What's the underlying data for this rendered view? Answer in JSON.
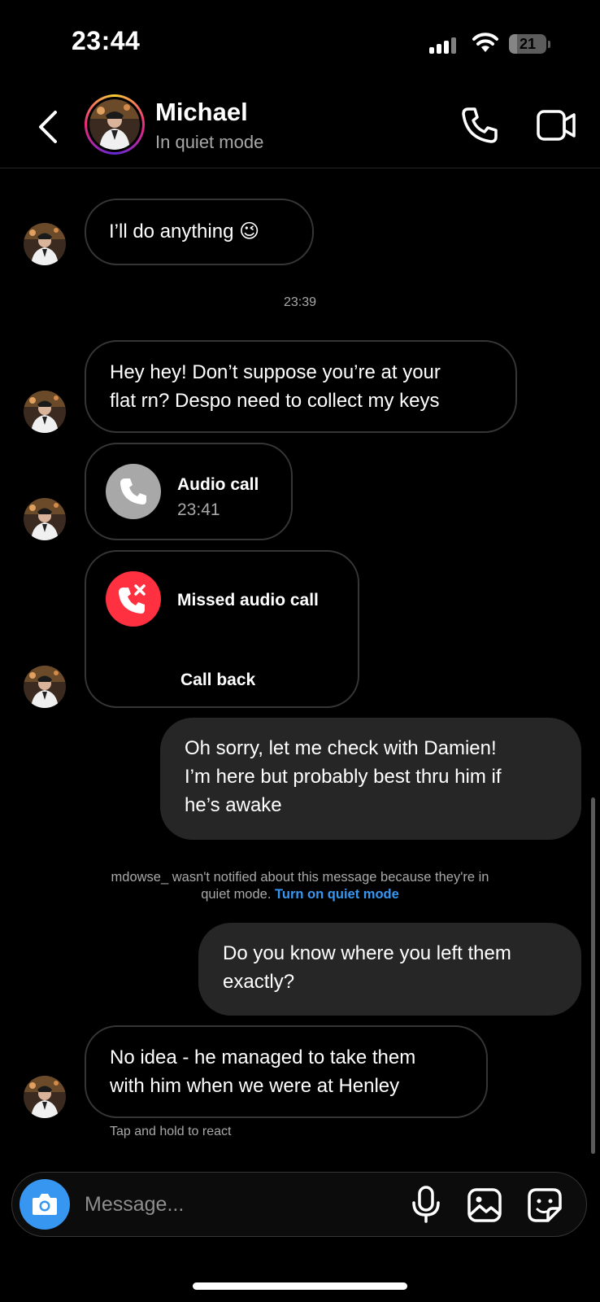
{
  "status_bar": {
    "time": "23:44",
    "battery": "21",
    "battery_level": 0.21
  },
  "header": {
    "name": "Michael",
    "status": "In quiet mode",
    "icons": {
      "back": "chevron-left-icon",
      "call": "phone-icon",
      "video": "video-camera-icon"
    }
  },
  "messages": {
    "m1": {
      "text": "I’ll do anything 😉"
    },
    "time1": "23:39",
    "m2": {
      "line1": "Hey hey! Don’t suppose you’re at your",
      "line2": "flat rn? Despo need to collect my keys"
    },
    "audio_call": {
      "title": "Audio call",
      "time": "23:41"
    },
    "missed_call": {
      "title": "Missed audio call",
      "action": "Call back"
    },
    "out1": {
      "line1": "Oh sorry, let me check with Damien!",
      "line2": "I’m here but probably best thru him if",
      "line3": "he’s awake"
    },
    "notice": {
      "text": "mdowse_ wasn't notified about this message because they're in",
      "text2": "quiet mode.",
      "link": "Turn on quiet mode"
    },
    "out2": {
      "line1": "Do you know where you left them",
      "line2": "exactly?"
    },
    "m3": {
      "line1": "No idea - he managed to take them",
      "line2": "with him when we were at Henley"
    },
    "react_hint": "Tap and hold to react"
  },
  "composer": {
    "placeholder": "Message...",
    "icons": {
      "camera": "camera-icon",
      "mic": "microphone-icon",
      "gallery": "image-icon",
      "sticker": "sticker-icon"
    }
  },
  "colors": {
    "accent": "#3797f0",
    "missed": "#ff3040",
    "bubble_out": "#262626",
    "muted": "#a8a8a8"
  }
}
